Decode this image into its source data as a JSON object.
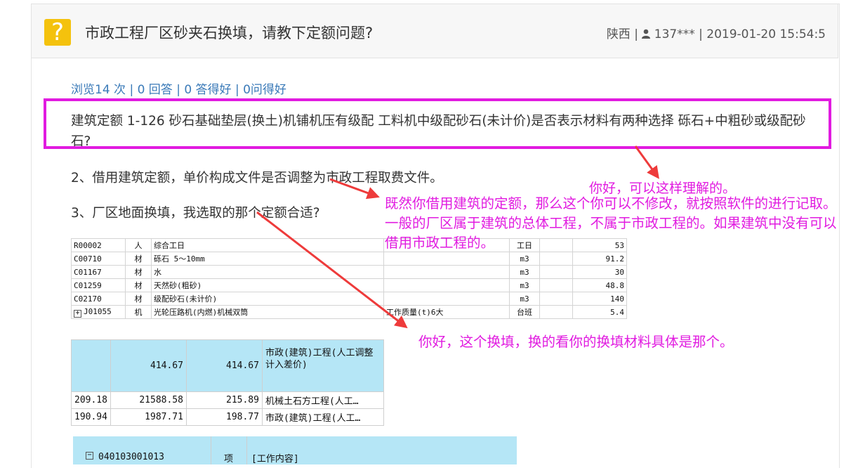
{
  "header": {
    "title": "市政工程厂区砂夹石换填，请教下定额问题?",
    "icon": "question-icon",
    "region": "陕西",
    "separator": "|",
    "user": "137***",
    "datetime": "2019-01-20 15:54:5"
  },
  "stats": "浏览14 次 | 0 回答 | 0 答得好 | 0问得好",
  "question": {
    "p1": "建筑定额 1-126 砂石基础垫层(换土)机铺机压有级配 工料机中级配砂石(未计价)是否表示材料有两种选择 砾石+中粗砂或级配砂石?",
    "p2": "2、借用建筑定额，单价构成文件是否调整为市政工程取费文件。",
    "p3": "3、厂区地面换填，我选取的那个定额合适?"
  },
  "annotations": {
    "a1": "你好，可以这样理解的。",
    "a2": "既然你借用建筑的定额，那么这个你可以不修改，就按照软件的进行记取。一般的厂区属于建筑的总体工程，不属于市政工程的。如果建筑中没有可以借用市政工程的。",
    "a3": "你好，这个换填，换的看你的换填材料具体是那个。",
    "color": "#e11be0"
  },
  "table1": {
    "rows": [
      {
        "code": "R00002",
        "type": "人",
        "name": "综合工日",
        "spec": "",
        "unit": "工日",
        "qty": "53"
      },
      {
        "code": "C00710",
        "type": "材",
        "name": "砾石 5～10mm",
        "spec": "",
        "unit": "m3",
        "qty": "91.2"
      },
      {
        "code": "C01167",
        "type": "材",
        "name": "水",
        "spec": "",
        "unit": "m3",
        "qty": "30"
      },
      {
        "code": "C01259",
        "type": "材",
        "name": "天然砂(粗砂)",
        "spec": "",
        "unit": "m3",
        "qty": "48.8"
      },
      {
        "code": "C02170",
        "type": "材",
        "name": "级配砂石(未计价)",
        "spec": "",
        "unit": "m3",
        "qty": "140"
      },
      {
        "code": "J01055",
        "type": "机",
        "name": "光轮压路机(内燃)机械双筒",
        "spec": "工作质量(t)6大",
        "unit": "台班",
        "qty": "5.4"
      }
    ]
  },
  "table2": {
    "rows": [
      {
        "a": "",
        "b": "414.67",
        "c": "414.67",
        "d": "市政(建筑)工程(人工调整计入差价)"
      },
      {
        "a": "209.18",
        "b": "21588.58",
        "c": "215.89",
        "d": "机械土石方工程(人工…"
      },
      {
        "a": "190.94",
        "b": "1987.71",
        "c": "198.77",
        "d": "市政(建筑)工程(人工…"
      }
    ]
  },
  "table3": {
    "code": "040103001013",
    "unit": "项",
    "content": "[工作内容]"
  }
}
